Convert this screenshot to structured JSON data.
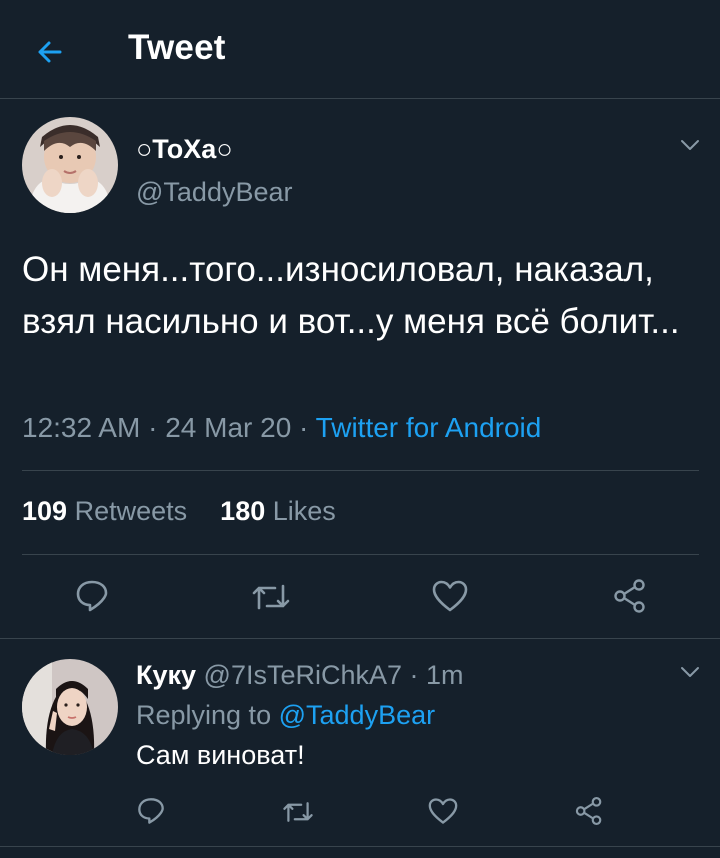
{
  "header": {
    "title": "Tweet"
  },
  "tweet": {
    "author_name": "○ToXa○",
    "author_handle": "@TaddyBear",
    "text": "Он меня...того...износиловал, наказал, взял насильно и вот...у меня всё болит...",
    "time": "12:32 AM",
    "date": "24 Mar 20",
    "sep": " · ",
    "source": "Twitter for Android",
    "retweets_count": "109",
    "retweets_label": "Retweets",
    "likes_count": "180",
    "likes_label": "Likes"
  },
  "reply": {
    "author_name": "Куку",
    "author_handle": "@7IsTeRiChkA7",
    "time_ago": "1m",
    "replying_prefix": "Replying to",
    "replying_to": "@TaddyBear",
    "text": "Сам виноват!"
  },
  "icons": {
    "back": "arrow-left-icon",
    "chevron": "chevron-down-icon",
    "reply": "comment-icon",
    "retweet": "retweet-icon",
    "like": "heart-icon",
    "share": "share-icon"
  },
  "colors": {
    "background": "#15202b",
    "accent": "#1da1f2",
    "secondary_text": "#8899a6",
    "divider": "#38444d"
  }
}
